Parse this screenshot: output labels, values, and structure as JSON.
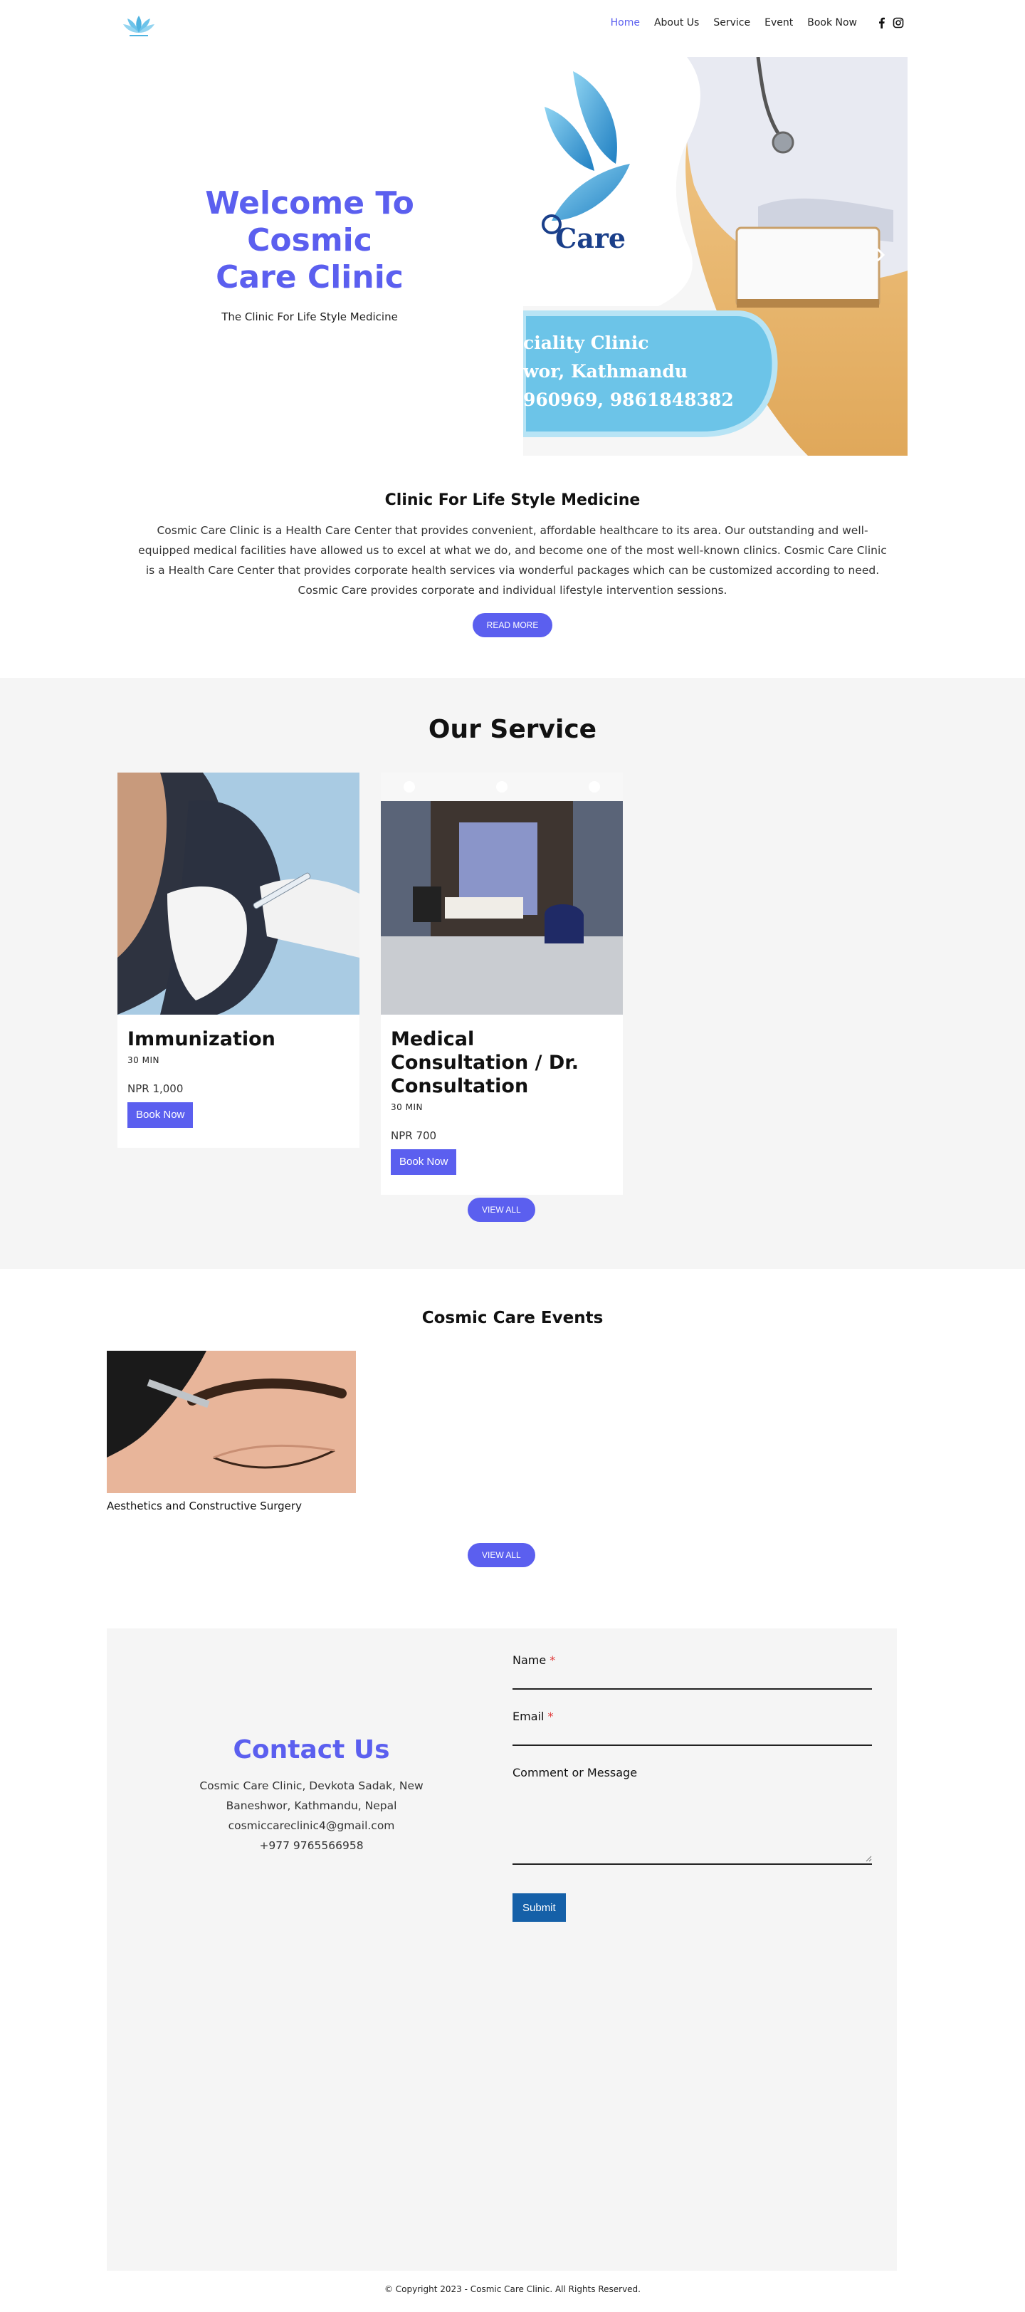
{
  "header": {
    "logo_icon": "lotus-logo-icon",
    "nav": [
      "Home",
      "About Us",
      "Service",
      "Event",
      "Book Now"
    ],
    "active_index": 0,
    "social": [
      "facebook-icon",
      "instagram-icon"
    ]
  },
  "hero": {
    "title_lines": [
      "Welcome To",
      "Cosmic",
      "Care Clinic"
    ],
    "subtitle": "The Clinic For Life Style Medicine",
    "slide": {
      "brand": "Care",
      "line1": "ciality Clinic",
      "line2": "wor, Kathmandu",
      "line3": "960969, 9861848382"
    },
    "next_icon": "chevron-right-icon"
  },
  "about": {
    "title": "Clinic For Life Style Medicine",
    "text": "Cosmic Care Clinic is a Health Care Center that provides convenient, affordable healthcare to its area. Our outstanding and well-equipped medical facilities have allowed us to excel at what we do, and become one of the most well-known clinics. Cosmic Care Clinic is a Health Care Center that provides corporate health services via wonderful packages which can be customized according to need. Cosmic Care provides corporate and individual lifestyle intervention sessions.",
    "button": "READ MORE"
  },
  "services": {
    "title": "Our Service",
    "items": [
      {
        "name": "Immunization",
        "duration": "30 MIN",
        "price": "NPR 1,000",
        "button": "Book Now"
      },
      {
        "name": "Medical Consultation / Dr. Consultation",
        "duration": "30 MIN",
        "price": "NPR 700",
        "button": "Book Now"
      }
    ],
    "button": "VIEW ALL"
  },
  "events": {
    "title": "Cosmic Care Events",
    "items": [
      {
        "caption": "Aesthetics and Constructive Surgery"
      }
    ],
    "button": "VIEW ALL"
  },
  "contact": {
    "title": "Contact Us",
    "address": "Cosmic Care Clinic, Devkota Sadak, New Baneshwor, Kathmandu, Nepal",
    "email": "cosmiccareclinic4@gmail.com",
    "phone": "+977 9765566958",
    "form": {
      "name_label": "Name",
      "email_label": "Email",
      "required_mark": "*",
      "message_label": "Comment or Message",
      "submit": "Submit"
    }
  },
  "footer": {
    "copyright": "© Copyright 2023 - Cosmic Care Clinic. All Rights Reserved."
  },
  "colors": {
    "accent": "#5b5fef",
    "submit": "#1560a8",
    "section_bg": "#f5f5f5"
  }
}
